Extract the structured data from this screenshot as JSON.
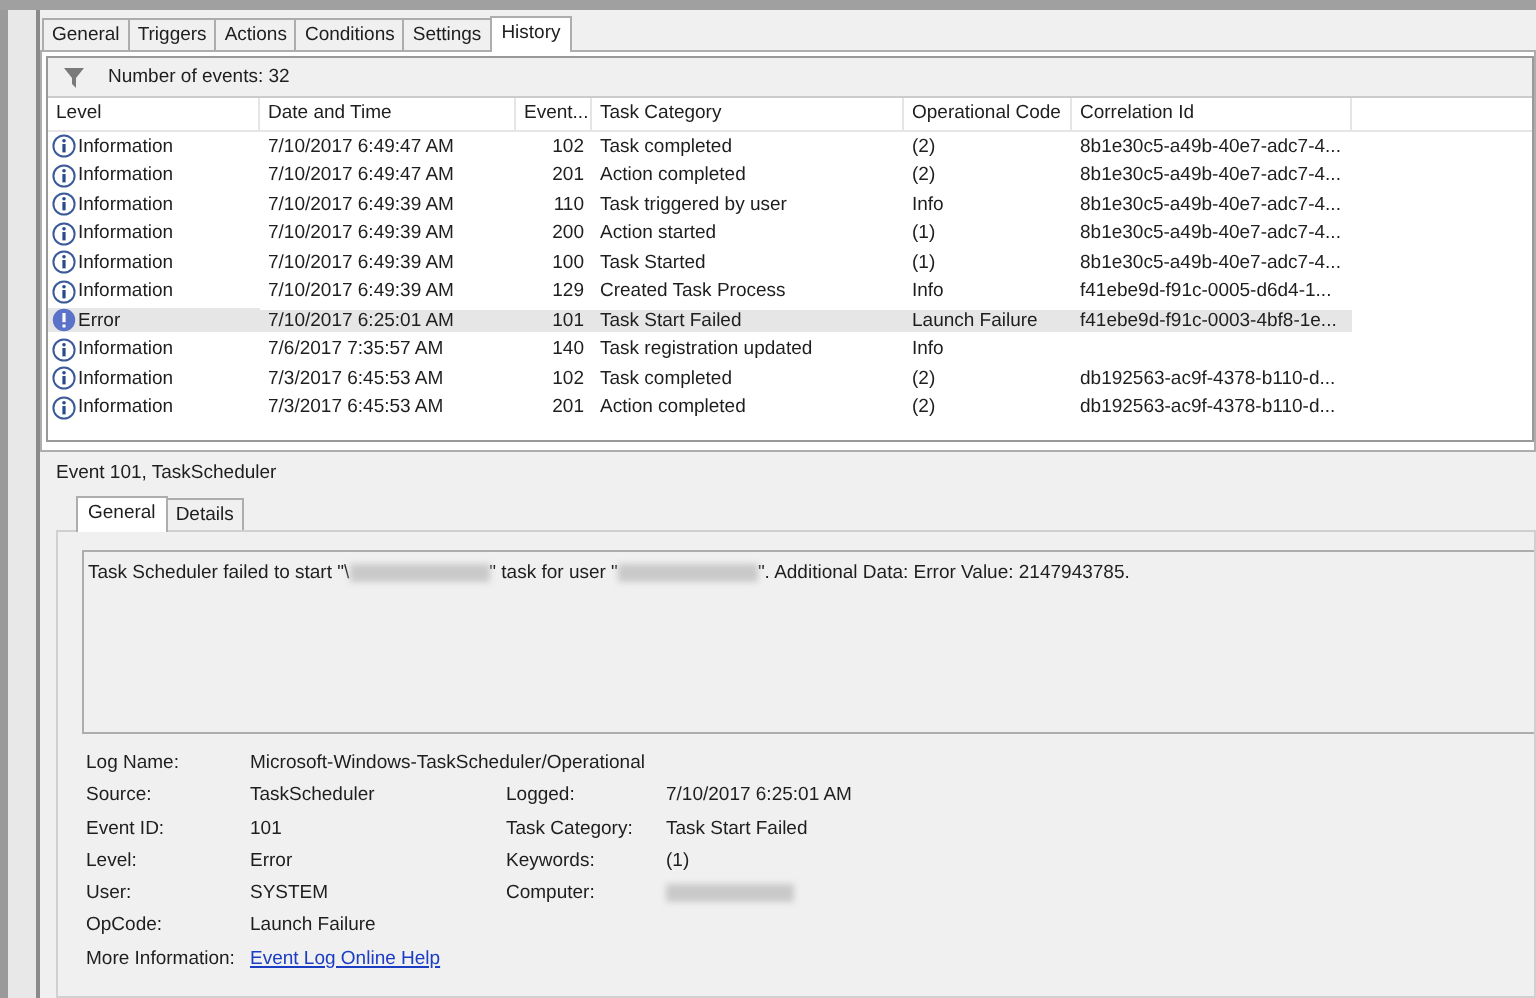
{
  "tabs": [
    {
      "label": "General",
      "selected": false
    },
    {
      "label": "Triggers",
      "selected": false
    },
    {
      "label": "Actions",
      "selected": false
    },
    {
      "label": "Conditions",
      "selected": false
    },
    {
      "label": "Settings",
      "selected": false
    },
    {
      "label": "History",
      "selected": true
    }
  ],
  "filter_bar": {
    "text": "Number of events: 32"
  },
  "table": {
    "columns": [
      "Level",
      "Date and Time",
      "Event...",
      "Task Category",
      "Operational Code",
      "Correlation Id"
    ],
    "rows": [
      {
        "kind": "information",
        "selected": false,
        "cells": [
          "Information",
          "7/10/2017 6:49:47 AM",
          "102",
          "Task completed",
          "(2)",
          "8b1e30c5-a49b-40e7-adc7-4..."
        ]
      },
      {
        "kind": "information",
        "selected": false,
        "cells": [
          "Information",
          "7/10/2017 6:49:47 AM",
          "201",
          "Action completed",
          "(2)",
          "8b1e30c5-a49b-40e7-adc7-4..."
        ]
      },
      {
        "kind": "information",
        "selected": false,
        "cells": [
          "Information",
          "7/10/2017 6:49:39 AM",
          "110",
          "Task triggered by user",
          "Info",
          "8b1e30c5-a49b-40e7-adc7-4..."
        ]
      },
      {
        "kind": "information",
        "selected": false,
        "cells": [
          "Information",
          "7/10/2017 6:49:39 AM",
          "200",
          "Action started",
          "(1)",
          "8b1e30c5-a49b-40e7-adc7-4..."
        ]
      },
      {
        "kind": "information",
        "selected": false,
        "cells": [
          "Information",
          "7/10/2017 6:49:39 AM",
          "100",
          "Task Started",
          "(1)",
          "8b1e30c5-a49b-40e7-adc7-4..."
        ]
      },
      {
        "kind": "information",
        "selected": false,
        "cells": [
          "Information",
          "7/10/2017 6:49:39 AM",
          "129",
          "Created Task Process",
          "Info",
          "f41ebe9d-f91c-0005-d6d4-1..."
        ]
      },
      {
        "kind": "error",
        "selected": true,
        "cells": [
          "Error",
          "7/10/2017 6:25:01 AM",
          "101",
          "Task Start Failed",
          "Launch Failure",
          "f41ebe9d-f91c-0003-4bf8-1e..."
        ]
      },
      {
        "kind": "information",
        "selected": false,
        "cells": [
          "Information",
          "7/6/2017 7:35:57 AM",
          "140",
          "Task registration updated",
          "Info",
          ""
        ]
      },
      {
        "kind": "information",
        "selected": false,
        "cells": [
          "Information",
          "7/3/2017 6:45:53 AM",
          "102",
          "Task completed",
          "(2)",
          "db192563-ac9f-4378-b110-d..."
        ]
      },
      {
        "kind": "information",
        "selected": false,
        "cells": [
          "Information",
          "7/3/2017 6:45:53 AM",
          "201",
          "Action completed",
          "(2)",
          "db192563-ac9f-4378-b110-d..."
        ]
      }
    ]
  },
  "detail": {
    "title": "Event 101, TaskScheduler",
    "tabs": [
      {
        "label": "General",
        "selected": true
      },
      {
        "label": "Details",
        "selected": false
      }
    ],
    "message_parts": [
      {
        "kind": "text",
        "text": "Task Scheduler failed to start \"\\"
      },
      {
        "kind": "redacted"
      },
      {
        "kind": "text",
        "text": "\" task for user \""
      },
      {
        "kind": "redacted"
      },
      {
        "kind": "text",
        "text": "\". Additional Data: Error Value: 2147943785."
      }
    ],
    "properties": [
      {
        "label": "Log Name:",
        "value": "Microsoft-Windows-TaskScheduler/Operational"
      },
      {
        "label": "Source:",
        "value": "TaskScheduler",
        "label_2": "Logged:",
        "value_2": "7/10/2017 6:25:01 AM"
      },
      {
        "label": "Event ID:",
        "value": "101",
        "label_2": "Task Category:",
        "value_2": "Task Start Failed"
      },
      {
        "label": "Level:",
        "value": "Error",
        "label_2": "Keywords:",
        "value_2": "(1)"
      },
      {
        "label": "User:",
        "value": "SYSTEM",
        "label_2": "Computer:",
        "redacted_2": true
      },
      {
        "label": "OpCode:",
        "value": "Launch Failure"
      },
      {
        "label": "More Information:",
        "link": "Event Log Online Help"
      }
    ]
  }
}
